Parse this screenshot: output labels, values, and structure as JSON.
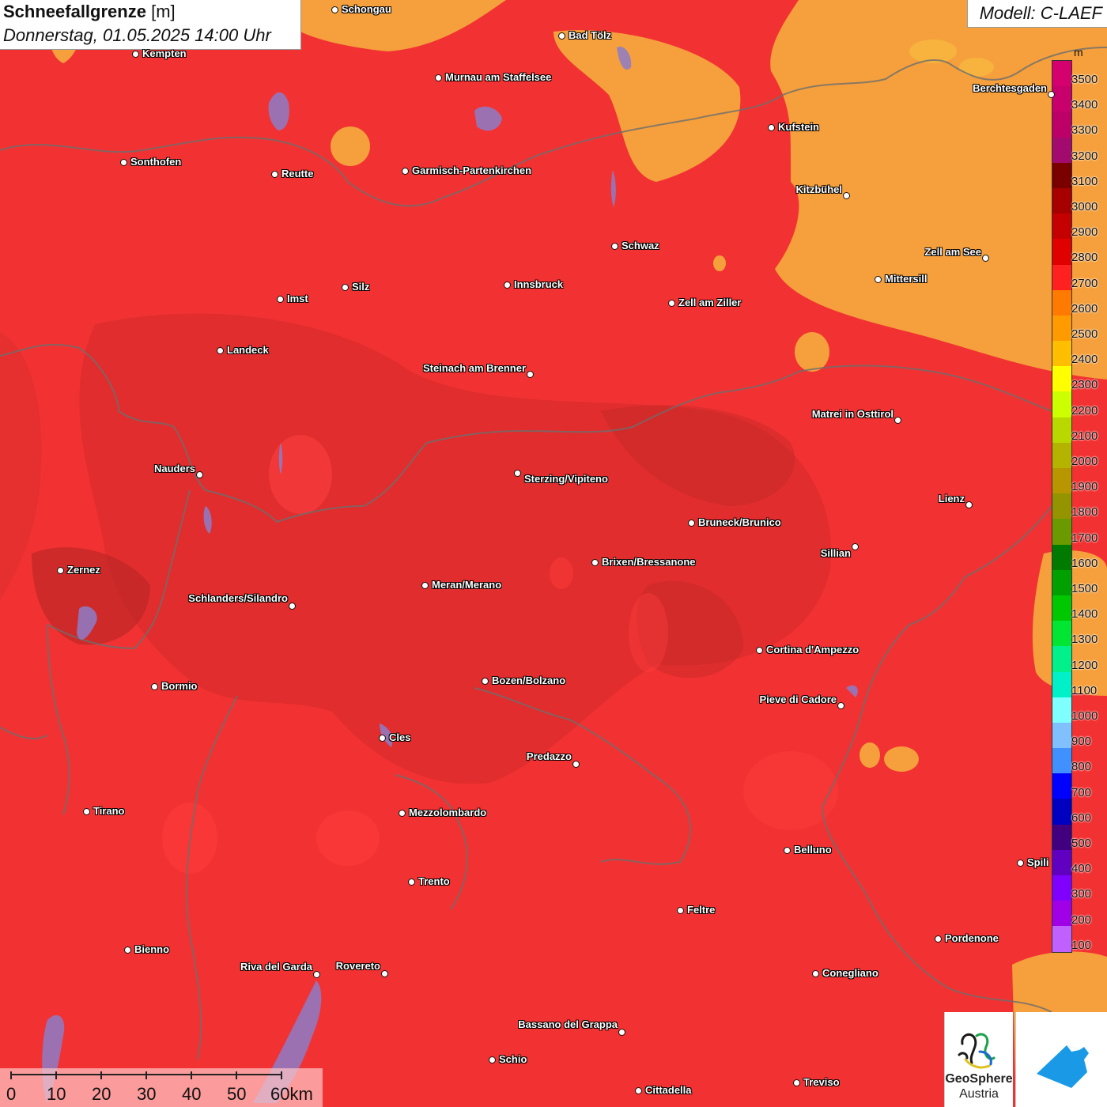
{
  "header": {
    "title": "Schneefallgrenze",
    "unit": "[m]",
    "datetime": "Donnerstag, 01.05.2025 14:00 Uhr",
    "model": "Modell: C-LAEF"
  },
  "legend": {
    "unit": "m",
    "levels": [
      3500,
      3400,
      3300,
      3200,
      3100,
      3000,
      2900,
      2800,
      2700,
      2600,
      2500,
      2400,
      2300,
      2200,
      2100,
      2000,
      1900,
      1800,
      1700,
      1600,
      1500,
      1400,
      1300,
      1200,
      1100,
      1000,
      900,
      800,
      700,
      600,
      500,
      400,
      300,
      200,
      100
    ],
    "labels": [
      "3500",
      "3400",
      "3300",
      "3200",
      "3100",
      "3000",
      "2900",
      "2800",
      "2700",
      "2600",
      "2500",
      "2400",
      "2300",
      "2200",
      "2100",
      "2000",
      "1900",
      "1800",
      "1700",
      "1600",
      "1500",
      "1400",
      "1300",
      "1200",
      "1100",
      "1000",
      "900",
      "800",
      "700",
      "600",
      "500",
      "400",
      "300",
      "200",
      "100"
    ],
    "colors": [
      "#d4006e",
      "#c8006c",
      "#bc0068",
      "#a30a6e",
      "#7a0000",
      "#a60000",
      "#c40000",
      "#e00000",
      "#ff2020",
      "#ff7a00",
      "#ff9a00",
      "#ffbe00",
      "#ffff00",
      "#ccff00",
      "#b8d800",
      "#b4b400",
      "#b89600",
      "#949400",
      "#6b9a00",
      "#007a00",
      "#00a000",
      "#00c800",
      "#00e632",
      "#00f08c",
      "#00f0c8",
      "#80ffff",
      "#80c0ff",
      "#4090ff",
      "#0000ff",
      "#0000c0",
      "#400080",
      "#6000c0",
      "#8000ff",
      "#a000e6",
      "#c060ff"
    ]
  },
  "cities": [
    {
      "name": "Schongau"
    },
    {
      "name": "Kempten"
    },
    {
      "name": "Bad Tölz"
    },
    {
      "name": "Murnau am Staffelsee"
    },
    {
      "name": "Berchtesgaden"
    },
    {
      "name": "Kufstein"
    },
    {
      "name": "Sonthofen"
    },
    {
      "name": "Reutte"
    },
    {
      "name": "Garmisch-Partenkirchen"
    },
    {
      "name": "Kitzbühel"
    },
    {
      "name": "Schwaz"
    },
    {
      "name": "Zell am See"
    },
    {
      "name": "Mittersill"
    },
    {
      "name": "Innsbruck"
    },
    {
      "name": "Silz"
    },
    {
      "name": "Imst"
    },
    {
      "name": "Zell am Ziller"
    },
    {
      "name": "Landeck"
    },
    {
      "name": "Steinach am Brenner"
    },
    {
      "name": "Matrei in Osttirol"
    },
    {
      "name": "Nauders"
    },
    {
      "name": "Sterzing/Vipiteno"
    },
    {
      "name": "Lienz"
    },
    {
      "name": "Bruneck/Brunico"
    },
    {
      "name": "Sillian"
    },
    {
      "name": "Zernez"
    },
    {
      "name": "Brixen/Bressanone"
    },
    {
      "name": "Meran/Merano"
    },
    {
      "name": "Schlanders/Silandro"
    },
    {
      "name": "Cortina d'Ampezzo"
    },
    {
      "name": "Bormio"
    },
    {
      "name": "Bozen/Bolzano"
    },
    {
      "name": "Pieve di Cadore"
    },
    {
      "name": "Cles"
    },
    {
      "name": "Predazzo"
    },
    {
      "name": "Tirano"
    },
    {
      "name": "Mezzolombardo"
    },
    {
      "name": "Belluno"
    },
    {
      "name": "Spili"
    },
    {
      "name": "Trento"
    },
    {
      "name": "Feltre"
    },
    {
      "name": "Pordenone"
    },
    {
      "name": "Bienno"
    },
    {
      "name": "Riva del Garda"
    },
    {
      "name": "Rovereto"
    },
    {
      "name": "Conegliano"
    },
    {
      "name": "Bassano del Grappa"
    },
    {
      "name": "Schio"
    },
    {
      "name": "Treviso"
    },
    {
      "name": "Cittadella"
    }
  ],
  "scale": {
    "ticks": [
      "0",
      "10",
      "20",
      "30",
      "40",
      "50",
      "60km"
    ]
  },
  "logos": {
    "geosphere_line1": "GeoSphere",
    "geosphere_line2": "Austria"
  },
  "colors": {
    "map_red": "#f23232",
    "map_orange": "#f5a03c",
    "map_dark": "#d42a2a"
  }
}
